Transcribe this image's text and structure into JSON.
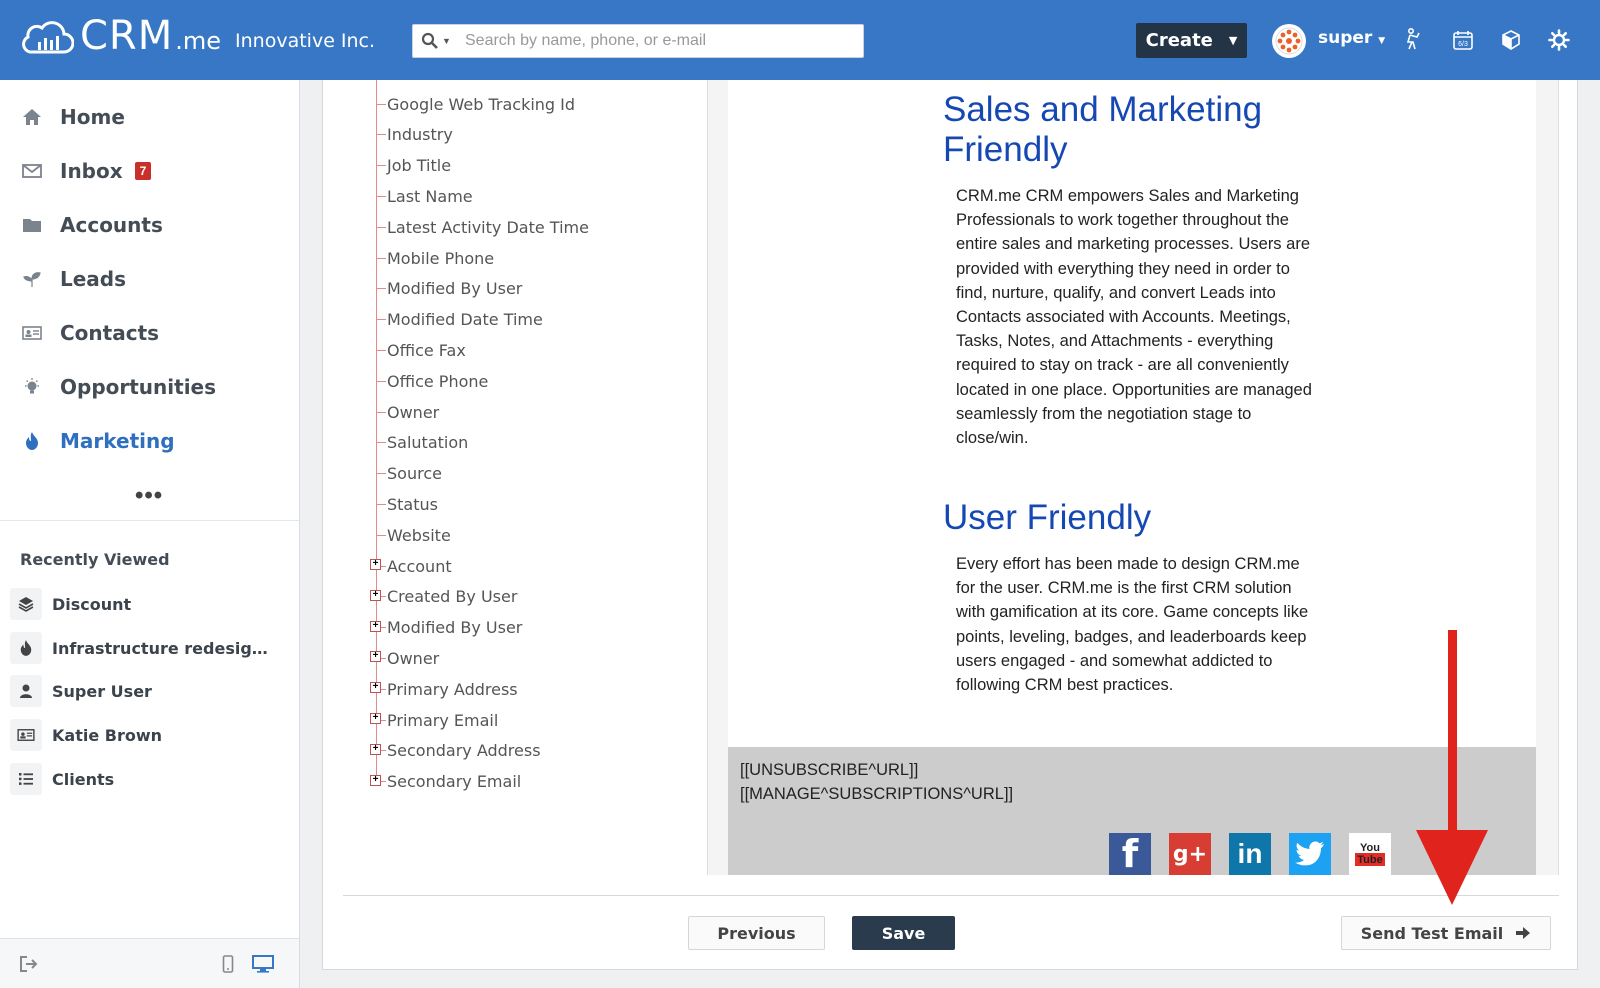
{
  "header": {
    "logo_main": "CRM",
    "logo_suffix": ".me",
    "company": "Innovative Inc.",
    "search_placeholder": "Search by name, phone, or e-mail",
    "create_label": "Create",
    "user_name": "super",
    "calendar_day": "6/3",
    "brand_color": "#3777c5"
  },
  "sidebar": {
    "nav": [
      {
        "label": "Home",
        "icon": "home-icon"
      },
      {
        "label": "Inbox",
        "icon": "mail-icon",
        "badge": "7"
      },
      {
        "label": "Accounts",
        "icon": "folder-icon"
      },
      {
        "label": "Leads",
        "icon": "sprout-icon"
      },
      {
        "label": "Contacts",
        "icon": "id-card-icon"
      },
      {
        "label": "Opportunities",
        "icon": "lightbulb-icon"
      },
      {
        "label": "Marketing",
        "icon": "flame-icon",
        "active": true
      }
    ],
    "more": "•••",
    "recent_title": "Recently Viewed",
    "recent": [
      {
        "label": "Discount",
        "icon": "layers-icon"
      },
      {
        "label": "Infrastructure redesign c...",
        "icon": "flame-icon"
      },
      {
        "label": "Super User",
        "icon": "person-icon"
      },
      {
        "label": "Katie Brown",
        "icon": "id-card-icon"
      },
      {
        "label": "Clients",
        "icon": "list-icon"
      }
    ]
  },
  "tree": {
    "fields": [
      "Google Web Tracking Id",
      "Industry",
      "Job Title",
      "Last Name",
      "Latest Activity Date Time",
      "Mobile Phone",
      "Modified By User",
      "Modified Date Time",
      "Office Fax",
      "Office Phone",
      "Owner",
      "Salutation",
      "Source",
      "Status",
      "Website"
    ],
    "groups": [
      "Account",
      "Created By User",
      "Modified By User",
      "Owner",
      "Primary Address",
      "Primary Email",
      "Secondary Address",
      "Secondary Email"
    ]
  },
  "email": {
    "heading1": "Sales and Marketing Friendly",
    "para1": "CRM.me CRM empowers Sales and Marketing Professionals to work together throughout the entire sales and marketing processes. Users are provided with everything they need in order to find, nurture, qualify, and convert Leads into Contacts associated with Accounts. Meetings, Tasks, Notes, and Attachments - everything required to stay on track - are all conveniently located in one place. Opportunities are managed seamlessly from the negotiation stage to close/win.",
    "heading2": "User Friendly",
    "para2": "Every effort has been made to design CRM.me for the user. CRM.me is the first CRM solution with gamification at its core. Game concepts like points, leveling, badges, and leaderboards keep users engaged - and somewhat addicted to following CRM best practices.",
    "unsubscribe": "[[UNSUBSCRIBE^URL]]",
    "manage": "[[MANAGE^SUBSCRIPTIONS^URL]]",
    "social": [
      {
        "name": "facebook-icon",
        "glyph": "f",
        "color": "#3b5998"
      },
      {
        "name": "google-plus-icon",
        "glyph": "g+",
        "color": "#d73d32"
      },
      {
        "name": "linkedin-icon",
        "glyph": "in",
        "color": "#0e76a8"
      },
      {
        "name": "twitter-icon",
        "glyph": "t",
        "color": "#1da1f2"
      },
      {
        "name": "youtube-icon",
        "glyph": "You Tube",
        "color": "#e52d27"
      }
    ]
  },
  "actions": {
    "previous": "Previous",
    "save": "Save",
    "send_test": "Send Test Email"
  }
}
